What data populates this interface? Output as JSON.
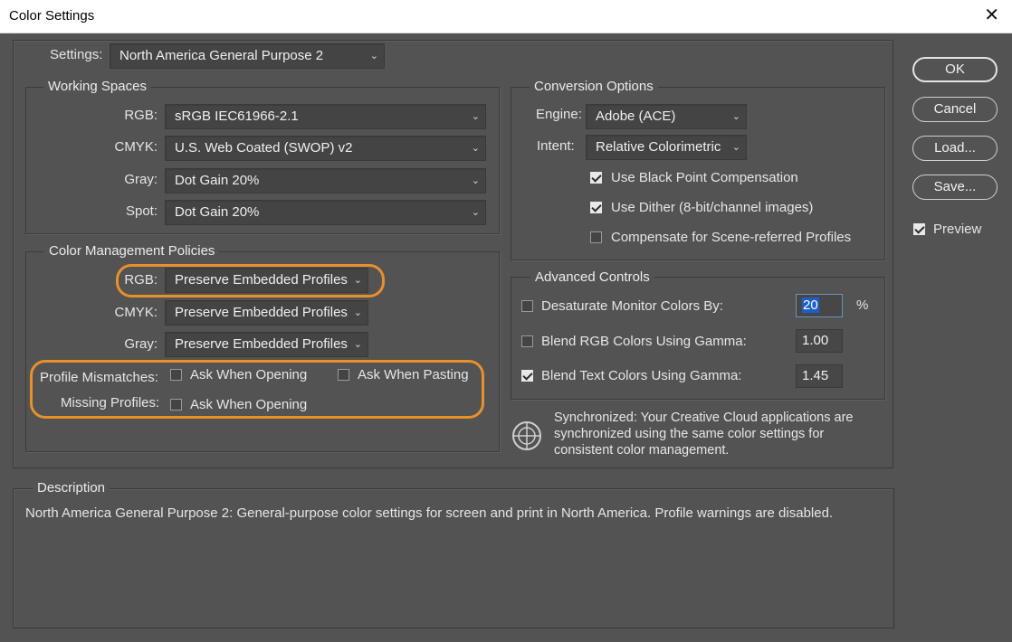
{
  "window": {
    "title": "Color Settings",
    "close_glyph": "✕"
  },
  "settings": {
    "label": "Settings:",
    "value": "North America General Purpose 2"
  },
  "working_spaces": {
    "title": "Working Spaces",
    "rgb": {
      "label": "RGB:",
      "value": "sRGB IEC61966-2.1"
    },
    "cmyk": {
      "label": "CMYK:",
      "value": "U.S. Web Coated (SWOP) v2"
    },
    "gray": {
      "label": "Gray:",
      "value": "Dot Gain 20%"
    },
    "spot": {
      "label": "Spot:",
      "value": "Dot Gain 20%"
    }
  },
  "policies": {
    "title": "Color Management Policies",
    "rgb": {
      "label": "RGB:",
      "value": "Preserve Embedded Profiles"
    },
    "cmyk": {
      "label": "CMYK:",
      "value": "Preserve Embedded Profiles"
    },
    "gray": {
      "label": "Gray:",
      "value": "Preserve Embedded Profiles"
    },
    "mismatches_label": "Profile Mismatches:",
    "ask_opening": {
      "label": "Ask When Opening",
      "checked": false
    },
    "ask_pasting": {
      "label": "Ask When Pasting",
      "checked": false
    },
    "missing_label": "Missing Profiles:",
    "missing_ask_opening": {
      "label": "Ask When Opening",
      "checked": false
    }
  },
  "conversion": {
    "title": "Conversion Options",
    "engine": {
      "label": "Engine:",
      "value": "Adobe (ACE)"
    },
    "intent": {
      "label": "Intent:",
      "value": "Relative Colorimetric"
    },
    "black_point": {
      "label": "Use Black Point Compensation",
      "checked": true
    },
    "dither": {
      "label": "Use Dither (8-bit/channel images)",
      "checked": true
    },
    "scene_referred": {
      "label": "Compensate for Scene-referred Profiles",
      "checked": false
    }
  },
  "advanced": {
    "title": "Advanced Controls",
    "desaturate": {
      "label": "Desaturate Monitor Colors By:",
      "checked": false,
      "value": "20",
      "unit": "%"
    },
    "blend_rgb": {
      "label": "Blend RGB Colors Using Gamma:",
      "checked": false,
      "value": "1.00"
    },
    "blend_text": {
      "label": "Blend Text Colors Using Gamma:",
      "checked": true,
      "value": "1.45"
    }
  },
  "sync": {
    "text": "Synchronized: Your Creative Cloud applications are synchronized using the same color settings for consistent color management."
  },
  "description": {
    "title": "Description",
    "text": "North America General Purpose 2:  General-purpose color settings for screen and print in North America. Profile warnings are disabled."
  },
  "buttons": {
    "ok": "OK",
    "cancel": "Cancel",
    "load": "Load...",
    "save": "Save..."
  },
  "preview": {
    "label": "Preview",
    "checked": true
  },
  "colors": {
    "background": "#535353",
    "highlight": "#e8902a",
    "selection": "#1d5fc8"
  }
}
